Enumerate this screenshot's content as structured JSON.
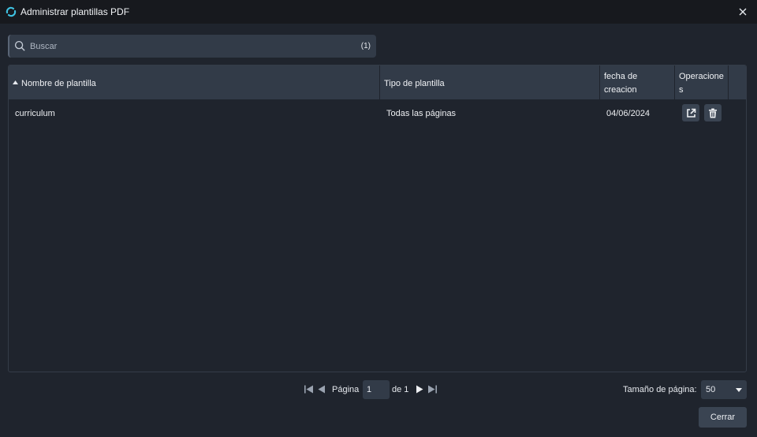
{
  "window": {
    "title": "Administrar plantillas PDF"
  },
  "search": {
    "placeholder": "Buscar",
    "count": "(1)"
  },
  "table": {
    "columns": [
      "Nombre de plantilla",
      "Tipo de plantilla",
      "fecha de creacion",
      "Operaciones"
    ],
    "columns_display": {
      "date_line1": "fecha de",
      "date_line2": "creacion",
      "ops_line1": "Operacione",
      "ops_line2": "s"
    },
    "rows": [
      {
        "name": "curriculum",
        "type": "Todas las páginas",
        "date": "04/06/2024"
      }
    ]
  },
  "pager": {
    "page_label": "Página",
    "page_value": "1",
    "of_label": "de 1"
  },
  "page_size": {
    "label": "Tamaño de página:",
    "value": "50"
  },
  "footer": {
    "close_label": "Cerrar"
  },
  "colors": {
    "accent": "#3fc1e0",
    "header_bg": "#323b48",
    "background": "#1f242d"
  }
}
